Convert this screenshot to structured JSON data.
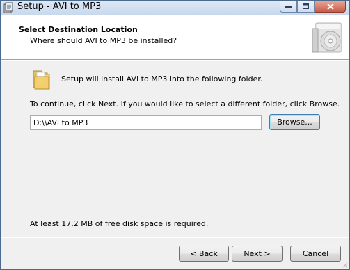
{
  "window": {
    "title": "Setup - AVI to MP3",
    "icon": "setup-installer-icon",
    "controls": {
      "minimize": "minimize-icon",
      "maximize": "maximize-icon",
      "close": "close-icon"
    }
  },
  "header": {
    "title": "Select Destination Location",
    "subtitle": "Where should AVI to MP3 be installed?",
    "icon": "cd-box-icon"
  },
  "content": {
    "folder_icon": "folder-icon",
    "message": "Setup will install AVI to MP3 into the following folder.",
    "instruction": "To continue, click Next. If you would like to select a different folder, click Browse.",
    "path_value": "D:\\\\AVI to MP3",
    "browse_label": "Browse...",
    "disk_space": "At least 17.2 MB of free disk space is required."
  },
  "footer": {
    "back_label": "< Back",
    "next_label": "Next >",
    "cancel_label": "Cancel"
  },
  "colors": {
    "content_bg": "#f0f0f0",
    "header_bg": "#ffffff",
    "default_button_border": "#3c7fb1",
    "close_button": "#c75c48"
  }
}
